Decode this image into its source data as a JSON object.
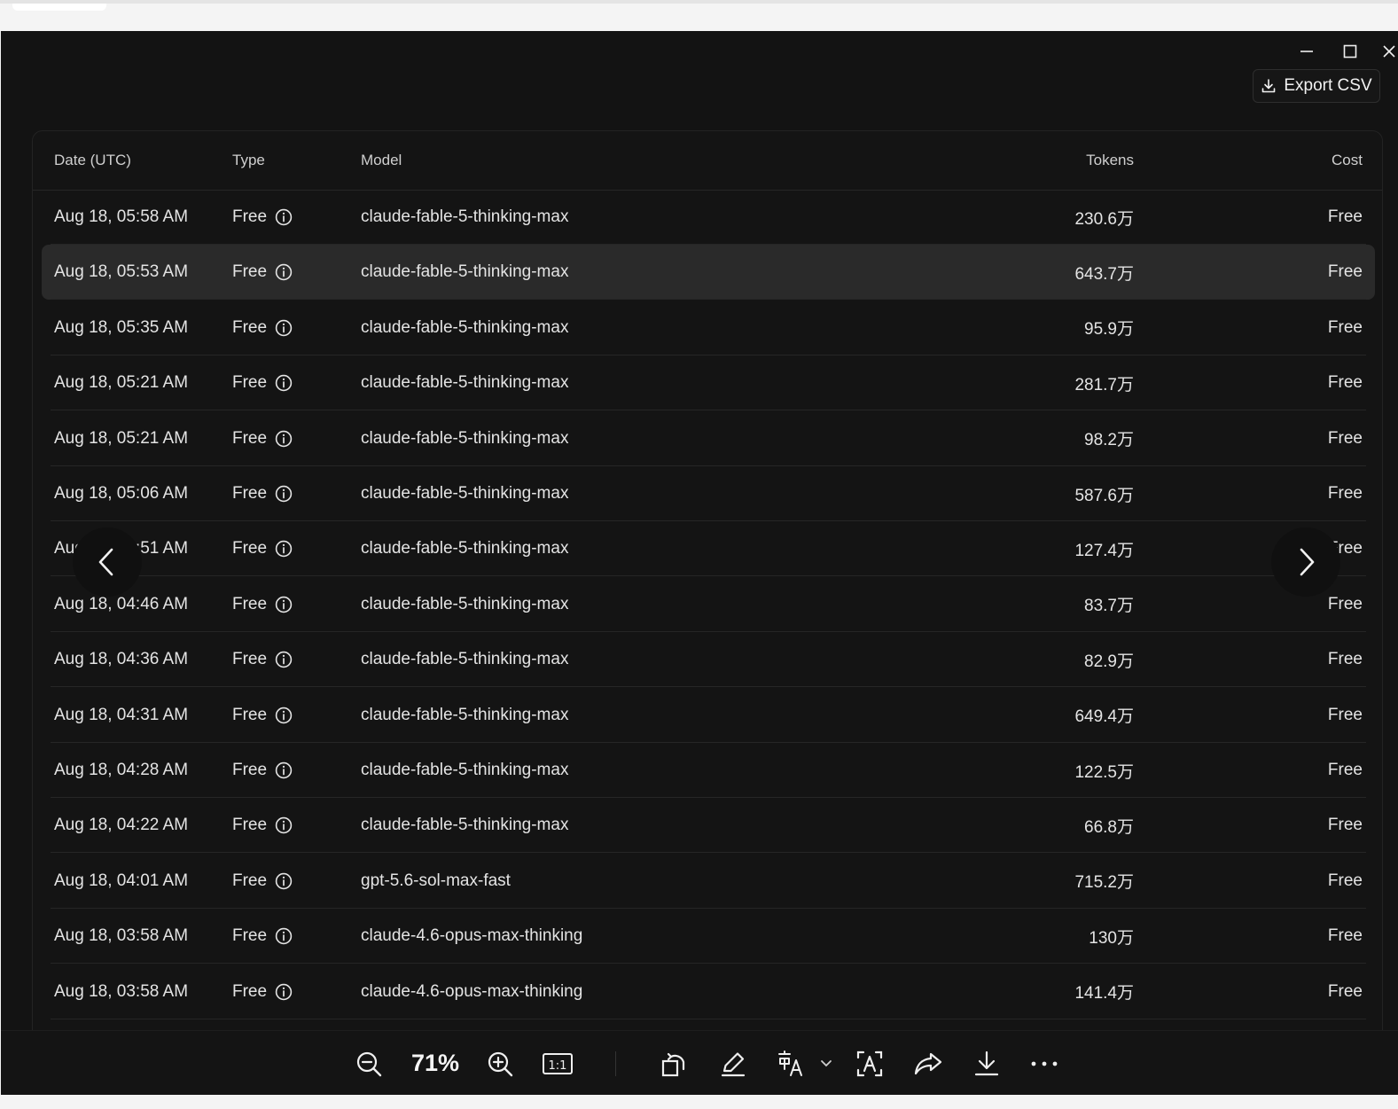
{
  "window": {
    "minimize_icon": "minimize-icon",
    "maximize_icon": "maximize-icon",
    "close_icon": "close-icon"
  },
  "export_button": {
    "label": "Export CSV",
    "icon": "download-icon"
  },
  "table": {
    "columns": [
      "Date (UTC)",
      "Type",
      "Model",
      "Tokens",
      "Cost"
    ],
    "highlighted_row_index": 1,
    "rows": [
      {
        "date": "Aug 18, 05:58 AM",
        "type": "Free",
        "model": "claude-fable-5-thinking-max",
        "tokens": "230.6万",
        "cost": "Free"
      },
      {
        "date": "Aug 18, 05:53 AM",
        "type": "Free",
        "model": "claude-fable-5-thinking-max",
        "tokens": "643.7万",
        "cost": "Free"
      },
      {
        "date": "Aug 18, 05:35 AM",
        "type": "Free",
        "model": "claude-fable-5-thinking-max",
        "tokens": "95.9万",
        "cost": "Free"
      },
      {
        "date": "Aug 18, 05:21 AM",
        "type": "Free",
        "model": "claude-fable-5-thinking-max",
        "tokens": "281.7万",
        "cost": "Free"
      },
      {
        "date": "Aug 18, 05:21 AM",
        "type": "Free",
        "model": "claude-fable-5-thinking-max",
        "tokens": "98.2万",
        "cost": "Free"
      },
      {
        "date": "Aug 18, 05:06 AM",
        "type": "Free",
        "model": "claude-fable-5-thinking-max",
        "tokens": "587.6万",
        "cost": "Free"
      },
      {
        "date": "Aug 18, 04:51 AM",
        "type": "Free",
        "model": "claude-fable-5-thinking-max",
        "tokens": "127.4万",
        "cost": "Free"
      },
      {
        "date": "Aug 18, 04:46 AM",
        "type": "Free",
        "model": "claude-fable-5-thinking-max",
        "tokens": "83.7万",
        "cost": "Free"
      },
      {
        "date": "Aug 18, 04:36 AM",
        "type": "Free",
        "model": "claude-fable-5-thinking-max",
        "tokens": "82.9万",
        "cost": "Free"
      },
      {
        "date": "Aug 18, 04:31 AM",
        "type": "Free",
        "model": "claude-fable-5-thinking-max",
        "tokens": "649.4万",
        "cost": "Free"
      },
      {
        "date": "Aug 18, 04:28 AM",
        "type": "Free",
        "model": "claude-fable-5-thinking-max",
        "tokens": "122.5万",
        "cost": "Free"
      },
      {
        "date": "Aug 18, 04:22 AM",
        "type": "Free",
        "model": "claude-fable-5-thinking-max",
        "tokens": "66.8万",
        "cost": "Free"
      },
      {
        "date": "Aug 18, 04:01 AM",
        "type": "Free",
        "model": "gpt-5.6-sol-max-fast",
        "tokens": "715.2万",
        "cost": "Free"
      },
      {
        "date": "Aug 18, 03:58 AM",
        "type": "Free",
        "model": "claude-4.6-opus-max-thinking",
        "tokens": "130万",
        "cost": "Free"
      },
      {
        "date": "Aug 18, 03:58 AM",
        "type": "Free",
        "model": "claude-4.6-opus-max-thinking",
        "tokens": "141.4万",
        "cost": "Free"
      }
    ]
  },
  "viewer_nav": {
    "prev_icon": "chevron-left-icon",
    "next_icon": "chevron-right-icon"
  },
  "toolbar": {
    "zoom_level": "71%",
    "items": [
      "zoom-out-icon",
      "zoom-in-icon",
      "actual-size-icon",
      "rotate-icon",
      "edit-icon",
      "translate-icon",
      "dropdown-chevron-icon",
      "text-recognition-icon",
      "share-icon",
      "download-icon",
      "more-icon"
    ]
  }
}
